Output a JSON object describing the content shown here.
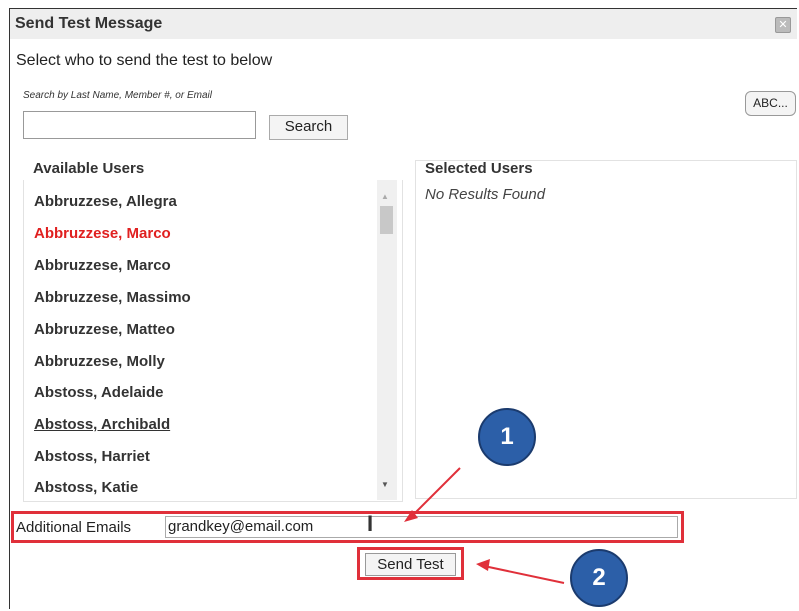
{
  "dialog": {
    "title": "Send Test Message",
    "close_icon": "close-icon"
  },
  "subtitle": "Select who to send the test to below",
  "search": {
    "label": "Search by Last Name, Member #, or Email",
    "value": "",
    "button": "Search"
  },
  "abc_button": "ABC...",
  "available": {
    "header": "Available Users",
    "users": [
      "Abbruzzese, Allegra",
      "Abbruzzese, Marco",
      "Abbruzzese, Marco",
      "Abbruzzese, Massimo",
      "Abbruzzese, Matteo",
      "Abbruzzese, Molly",
      "Abstoss, Adelaide",
      "Abstoss, Archibald",
      "Abstoss, Harriet",
      "Abstoss, Katie"
    ]
  },
  "selected": {
    "header": "Selected Users",
    "empty": "No Results Found"
  },
  "additional_emails": {
    "label": "Additional Emails",
    "value": "grandkey@email.com"
  },
  "send_button": "Send Test",
  "callouts": [
    "1",
    "2"
  ],
  "colors": {
    "highlight": "#e0303a",
    "selected_user": "#e02020",
    "callout": "#2c5fa8"
  }
}
